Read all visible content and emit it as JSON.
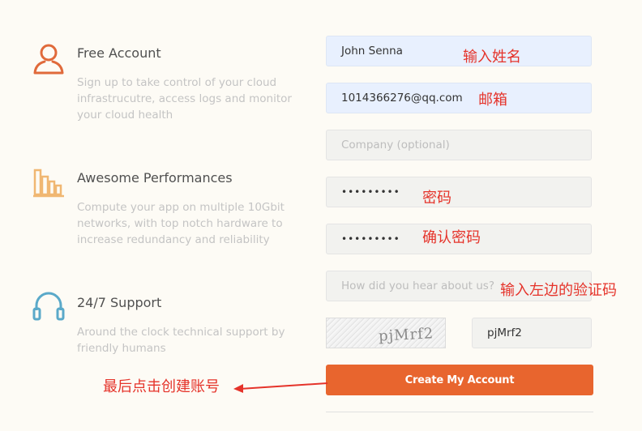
{
  "features": [
    {
      "title": "Free Account",
      "desc": "Sign up to take control of your cloud infrastrucutre, access logs and monitor your cloud health",
      "icon": "user-icon"
    },
    {
      "title": "Awesome Performances",
      "desc": "Compute your app on multiple 10Gbit networks, with top notch hardware to increase redundancy and reliability",
      "icon": "bar-chart-icon"
    },
    {
      "title": "24/7 Support",
      "desc": "Around the clock technical support by friendly humans",
      "icon": "headphones-icon"
    }
  ],
  "form": {
    "name_value": "John Senna",
    "email_value": "1014366276@qq.com",
    "company_placeholder": "Company (optional)",
    "password_value": "•••••••••",
    "confirm_value": "•••••••••",
    "hear_placeholder": "How did you hear about us?",
    "captcha_text": "pjMrf2",
    "captcha_value": "pjMrf2",
    "submit_label": "Create My Account"
  },
  "annotations": {
    "name": "输入姓名",
    "email": "邮箱",
    "password": "密码",
    "confirm": "确认密码",
    "captcha": "输入左边的验证码",
    "submit": "最后点击创建账号"
  },
  "colors": {
    "accent": "#e8652e",
    "annotation": "#e5332a",
    "autofill": "#e8f0fe",
    "icon_user": "#e06a3b",
    "icon_chart": "#f0b772",
    "icon_support": "#5aa9c9"
  }
}
